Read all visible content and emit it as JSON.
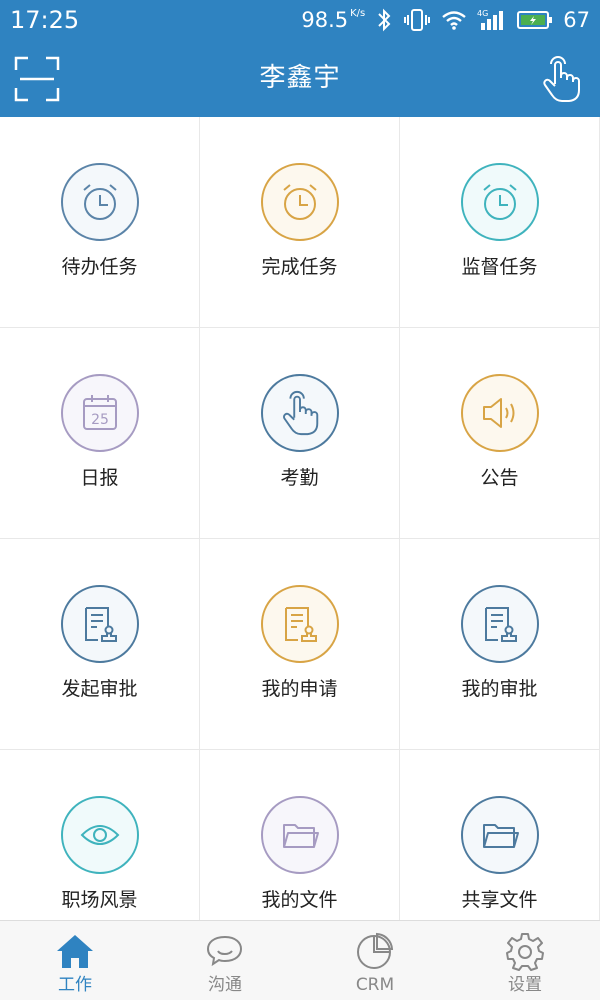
{
  "status_bar": {
    "time": "17:25",
    "net_speed": "98.5",
    "net_speed_unit": "K/s",
    "battery": "67"
  },
  "header": {
    "title": "李鑫宇",
    "left_icon": "scan-icon",
    "right_icon": "touch-hand-icon"
  },
  "grid": {
    "items": [
      {
        "label": "待办任务",
        "icon": "alarm-clock-icon",
        "color": "#5b84a8"
      },
      {
        "label": "完成任务",
        "icon": "alarm-clock-icon",
        "color": "#d8a445"
      },
      {
        "label": "监督任务",
        "icon": "alarm-clock-icon",
        "color": "#3fb3bd"
      },
      {
        "label": "日报",
        "icon": "calendar-icon",
        "color": "#a69bc2",
        "icon_text": "25"
      },
      {
        "label": "考勤",
        "icon": "touch-hand-icon",
        "color": "#4d7a9e"
      },
      {
        "label": "公告",
        "icon": "speaker-icon",
        "color": "#d8a445"
      },
      {
        "label": "发起审批",
        "icon": "approval-doc-icon",
        "color": "#4d7a9e"
      },
      {
        "label": "我的申请",
        "icon": "approval-doc-icon",
        "color": "#d8a445"
      },
      {
        "label": "我的审批",
        "icon": "approval-doc-icon",
        "color": "#4d7a9e"
      },
      {
        "label": "职场风景",
        "icon": "eye-icon",
        "color": "#3fb3bd"
      },
      {
        "label": "我的文件",
        "icon": "folder-icon",
        "color": "#a69bc2"
      },
      {
        "label": "共享文件",
        "icon": "folder-icon",
        "color": "#4d7a9e"
      }
    ]
  },
  "tabs": [
    {
      "label": "工作",
      "icon": "home-icon",
      "active": true
    },
    {
      "label": "沟通",
      "icon": "chat-bubbles-icon",
      "active": false
    },
    {
      "label": "CRM",
      "icon": "pie-chart-icon",
      "active": false
    },
    {
      "label": "设置",
      "icon": "gear-icon",
      "active": false
    }
  ],
  "colors": {
    "brand": "#2f83c1",
    "tab_active": "#2f83c1",
    "tab_inactive": "#888888"
  }
}
